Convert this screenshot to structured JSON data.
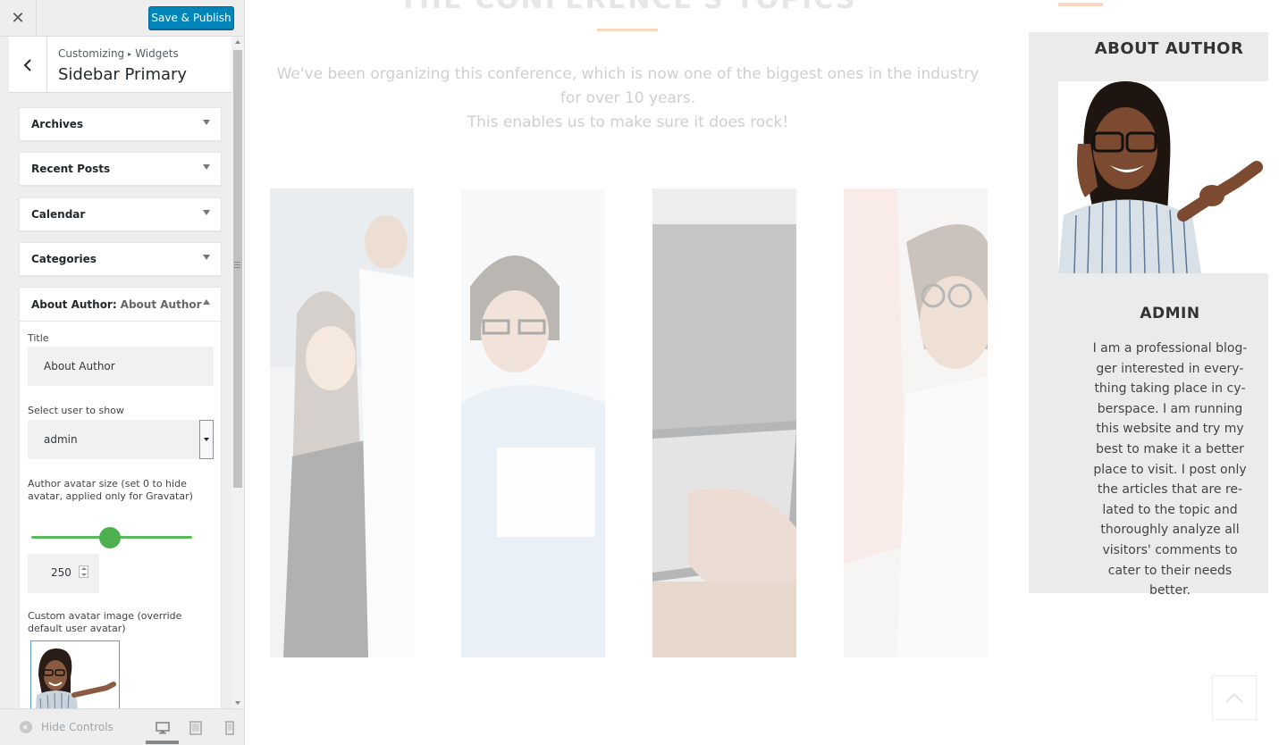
{
  "header": {
    "close_icon": "close-icon",
    "save_label": "Save & Publish"
  },
  "section": {
    "breadcrumb_1": "Customizing",
    "breadcrumb_sep": "▸",
    "breadcrumb_2": "Widgets",
    "title": "Sidebar Primary"
  },
  "widgets": [
    {
      "label": "Archives"
    },
    {
      "label": "Recent Posts"
    },
    {
      "label": "Calendar"
    },
    {
      "label": "Categories"
    }
  ],
  "open_widget": {
    "label": "About Author",
    "in_title_sep": ":",
    "in_title": "About Author",
    "title_label": "Title",
    "title_value": "About Author",
    "select_label": "Select user to show",
    "select_value": "admin",
    "size_label": "Author avatar size (set 0 to hide avatar, applied only for Gravatar)",
    "slider_fraction": 0.49,
    "size_value": "250",
    "custom_label": "Custom avatar image (override default user avatar)"
  },
  "footer": {
    "hide_label": "Hide Controls",
    "devices": [
      "desktop-icon",
      "tablet-icon",
      "mobile-icon"
    ]
  },
  "preview": {
    "hero_title": "THE CONFERENCE'S TOPICS",
    "hero_desc_1": "We've been organizing this conference, which is now one of the biggest ones in the industry for over 10 years.",
    "hero_desc_2": "This enables us to make sure it does rock!",
    "sidebar_title": "ABOUT AUTHOR",
    "author_name": "ADMIN",
    "author_bio": "I am a professional blog­ger interested in every­thing taking place in cy­berspace. I am running this website and try my best to make it a better place to visit. I post only the articles that are re­lated to the topic and thoroughly analyze all vis­itors' comments to cater to their needs better."
  },
  "colors": {
    "primary_button": "#0085ba",
    "slider": "#4caf50",
    "accent_line": "#fbd7c1"
  }
}
